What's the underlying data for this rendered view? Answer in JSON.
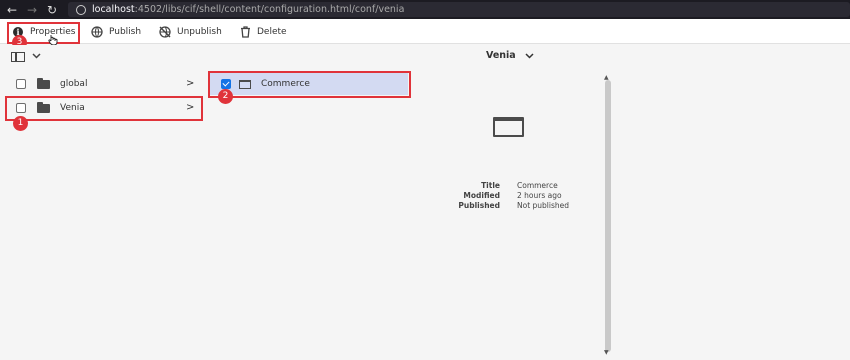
{
  "browser": {
    "back": "←",
    "forward": "→",
    "reload": "↻",
    "url_host": "localhost",
    "url_rest": ":4502/libs/cif/shell/content/configuration.html/conf/venia"
  },
  "actions": {
    "properties": "Properties",
    "publish": "Publish",
    "unpublish": "Unpublish",
    "delete": "Delete"
  },
  "header": {
    "title": "Venia"
  },
  "column1": [
    {
      "label": "global"
    },
    {
      "label": "Venia"
    }
  ],
  "column2": [
    {
      "label": "Commerce",
      "checked": true
    }
  ],
  "details": {
    "title_key": "Title",
    "title_val": "Commerce",
    "modified_key": "Modified",
    "modified_val": "2 hours ago",
    "published_key": "Published",
    "published_val": "Not published"
  },
  "annotations": {
    "one": "1",
    "two": "2",
    "three": "3"
  },
  "colors": {
    "highlight": "#e0333a",
    "selected_row": "#d3daf2",
    "checkbox": "#1473e6"
  },
  "icons": {
    "properties": "info-icon",
    "publish": "globe-icon",
    "unpublish": "globe-off-icon",
    "delete": "trash-icon"
  }
}
